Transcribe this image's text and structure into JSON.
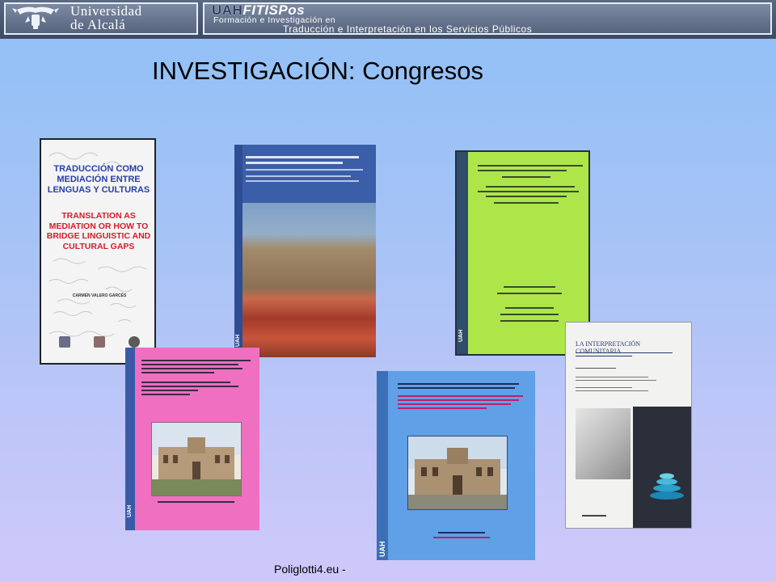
{
  "header": {
    "university_name_line1": "Universidad",
    "university_name_line2": "de Alcalá",
    "program_brand_part1": "UAH",
    "program_brand_part2": "FITISPos",
    "program_subtitle_line1": "Formación e Investigación en",
    "program_subtitle_line2": "Traducción e Interpretación en los Servicios Públicos"
  },
  "title": "INVESTIGACIÓN: Congresos",
  "covers": {
    "book1": {
      "title_es": "TRADUCCIÓN COMO MEDIACIÓN ENTRE LENGUAS Y CULTURAS",
      "title_en": "TRANSLATION AS MEDIATION OR HOW TO BRIDGE LINGUISTIC AND CULTURAL GAPS",
      "editor": "CARMEN VALERO GARCÉS"
    },
    "book2": {
      "spine_label": "UAH"
    },
    "book3": {
      "spine_label": "UAH"
    },
    "book4": {
      "spine_label": "UAH"
    },
    "book5": {
      "spine_label": "UAH"
    },
    "book6": {
      "title": "LA INTERPRETACIÓN COMUNITARIA"
    }
  },
  "colors": {
    "header_bg": "#4a5872",
    "book2_bg": "#3a5ea8",
    "book3_bg": "#aee64a",
    "book4_bg": "#ef6fc0",
    "book5_bg": "#5fa0e6",
    "book6_band": "#2a2f3a"
  },
  "footer": "Poliglotti4.eu -"
}
